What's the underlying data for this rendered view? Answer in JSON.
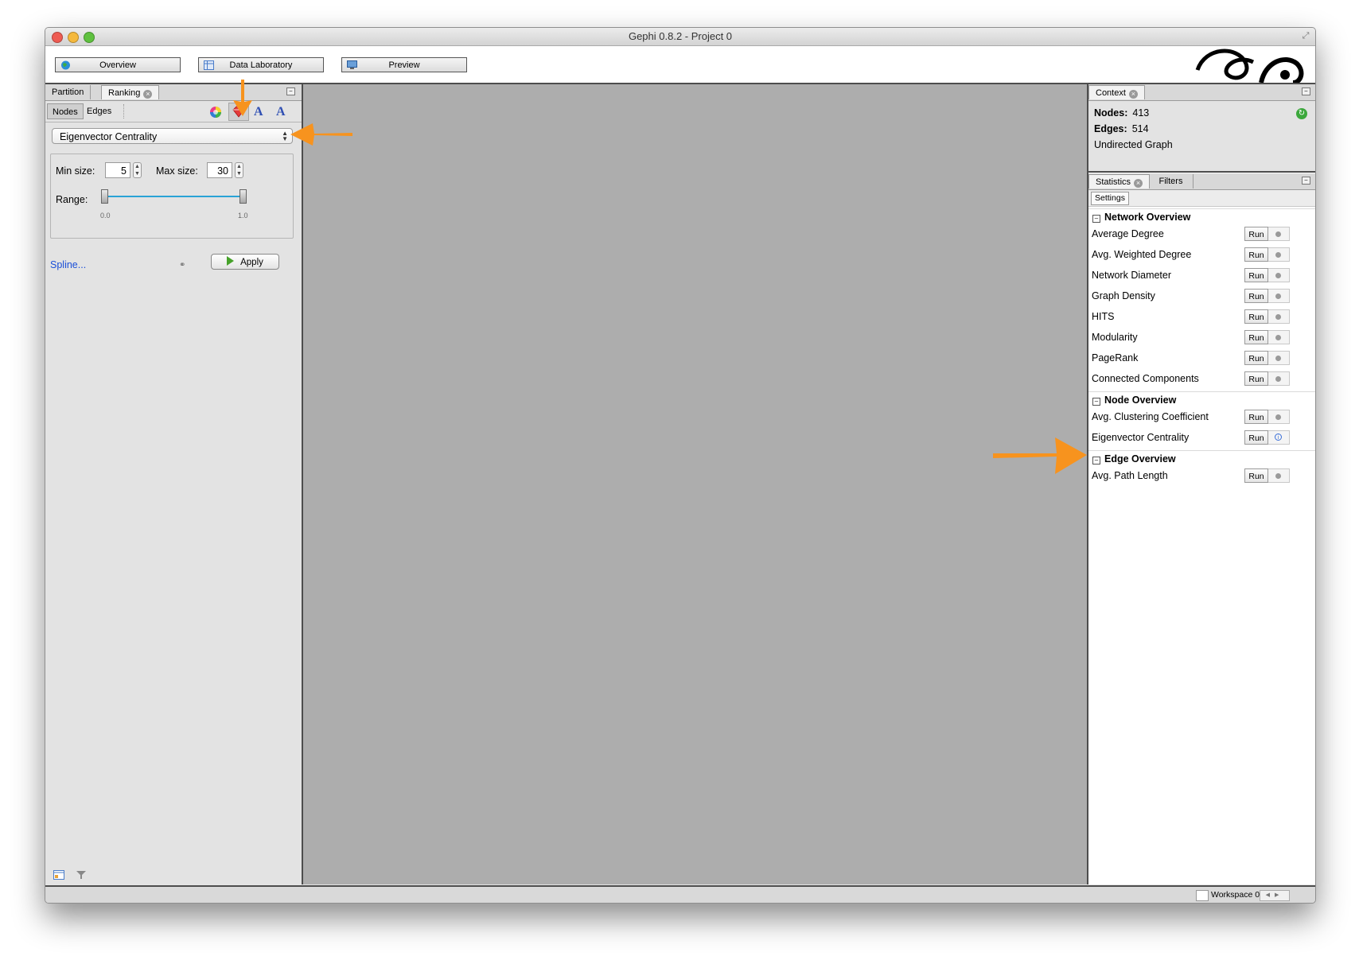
{
  "window": {
    "title": "Gephi 0.8.2 - Project 0"
  },
  "toolbar": {
    "modes": [
      "Overview",
      "Data Laboratory",
      "Preview"
    ]
  },
  "left_panel": {
    "tabs": [
      "Partition",
      "Ranking"
    ],
    "subtabs": [
      "Nodes",
      "Edges"
    ],
    "ranking_select": "Eigenvector Centrality",
    "min_size_label": "Min size:",
    "min_size_value": "5",
    "max_size_label": "Max size:",
    "max_size_value": "30",
    "range_label": "Range:",
    "range_min": "0.0",
    "range_max": "1.0",
    "spline_link": "Spline...",
    "apply_label": "Apply"
  },
  "context": {
    "tab": "Context",
    "nodes_label": "Nodes:",
    "nodes_value": "413",
    "edges_label": "Edges:",
    "edges_value": "514",
    "graph_type": "Undirected Graph"
  },
  "statistics": {
    "tabs": [
      "Statistics",
      "Filters"
    ],
    "settings_label": "Settings",
    "run_label": "Run",
    "sections": [
      {
        "title": "Network Overview",
        "items": [
          "Average Degree",
          "Avg. Weighted Degree",
          "Network Diameter",
          "Graph Density",
          "HITS",
          "Modularity",
          "PageRank",
          "Connected Components"
        ]
      },
      {
        "title": "Node Overview",
        "items": [
          "Avg. Clustering Coefficient",
          "Eigenvector Centrality"
        ]
      },
      {
        "title": "Edge Overview",
        "items": [
          "Avg. Path Length"
        ]
      }
    ]
  },
  "statusbar": {
    "workspace": "Workspace 0"
  },
  "colors": {
    "annotation_arrow": "#f7931e",
    "canvas_bg": "#adadad",
    "link": "#1a4fd8"
  }
}
